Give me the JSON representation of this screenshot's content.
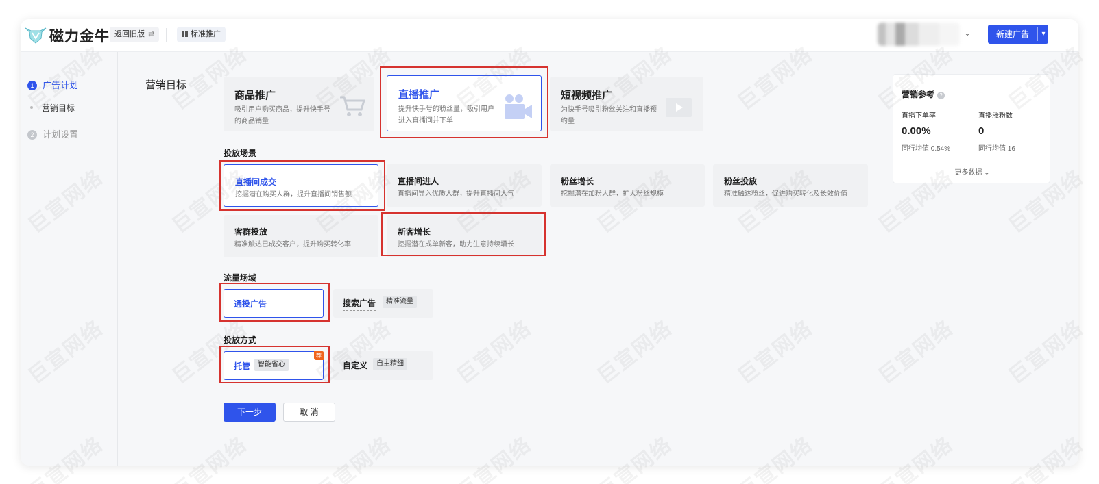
{
  "header": {
    "logo_text": "磁力金牛",
    "back_old_label": "返回旧版",
    "back_old_icon": "⇄",
    "std_promo_label": "标准推广",
    "new_ad_label": "新建广告",
    "new_ad_dropdown": "▾",
    "acct_chevron": "⌄"
  },
  "sidebar": {
    "step1_num": "1",
    "step1_label": "广告计划",
    "sub_label": "营销目标",
    "step2_num": "2",
    "step2_label": "计划设置"
  },
  "main": {
    "marketing_goal_title": "营销目标",
    "goals": [
      {
        "title": "商品推广",
        "desc": "吸引用户购买商品，提升快手号的商品销量"
      },
      {
        "title": "直播推广",
        "desc": "提升快手号的粉丝量，吸引用户进入直播间并下单"
      },
      {
        "title": "短视频推广",
        "desc": "为快手号吸引粉丝关注和直播预约量"
      }
    ],
    "scene_label": "投放场景",
    "scenes": [
      {
        "title": "直播间成交",
        "desc": "挖掘潜在购买人群，提升直播间销售额"
      },
      {
        "title": "直播间进人",
        "desc": "直播间导入优质人群，提升直播间人气"
      },
      {
        "title": "粉丝增长",
        "desc": "挖掘潜在加粉人群，扩大粉丝规模"
      },
      {
        "title": "粉丝投放",
        "desc": "精准触达粉丝，促进购买转化及长效价值"
      },
      {
        "title": "客群投放",
        "desc": "精准触达已成交客户，提升购买转化率"
      },
      {
        "title": "新客增长",
        "desc": "挖掘潜在成单新客，助力生意持续增长"
      }
    ],
    "traffic_label": "流量场域",
    "traffic": [
      {
        "title": "通投广告",
        "tag": ""
      },
      {
        "title": "搜索广告",
        "tag": "精准流量"
      }
    ],
    "method_label": "投放方式",
    "methods": [
      {
        "title": "托管",
        "tag": "智能省心",
        "badge": "荐"
      },
      {
        "title": "自定义",
        "tag": "自主精细",
        "badge": ""
      }
    ],
    "next_label": "下一步",
    "cancel_label": "取 消"
  },
  "reference": {
    "title": "营销参考",
    "help_icon": "?",
    "metrics": [
      {
        "label": "直播下单率",
        "value": "0.00%",
        "bench": "同行均值 0.54%"
      },
      {
        "label": "直播涨粉数",
        "value": "0",
        "bench": "同行均值 16"
      }
    ],
    "more_label": "更多数据 ⌄"
  },
  "watermark": "巨宣网络",
  "colors": {
    "accent": "#2f54eb",
    "annotation_red": "#d6332f",
    "badge_orange": "#f0641e"
  }
}
